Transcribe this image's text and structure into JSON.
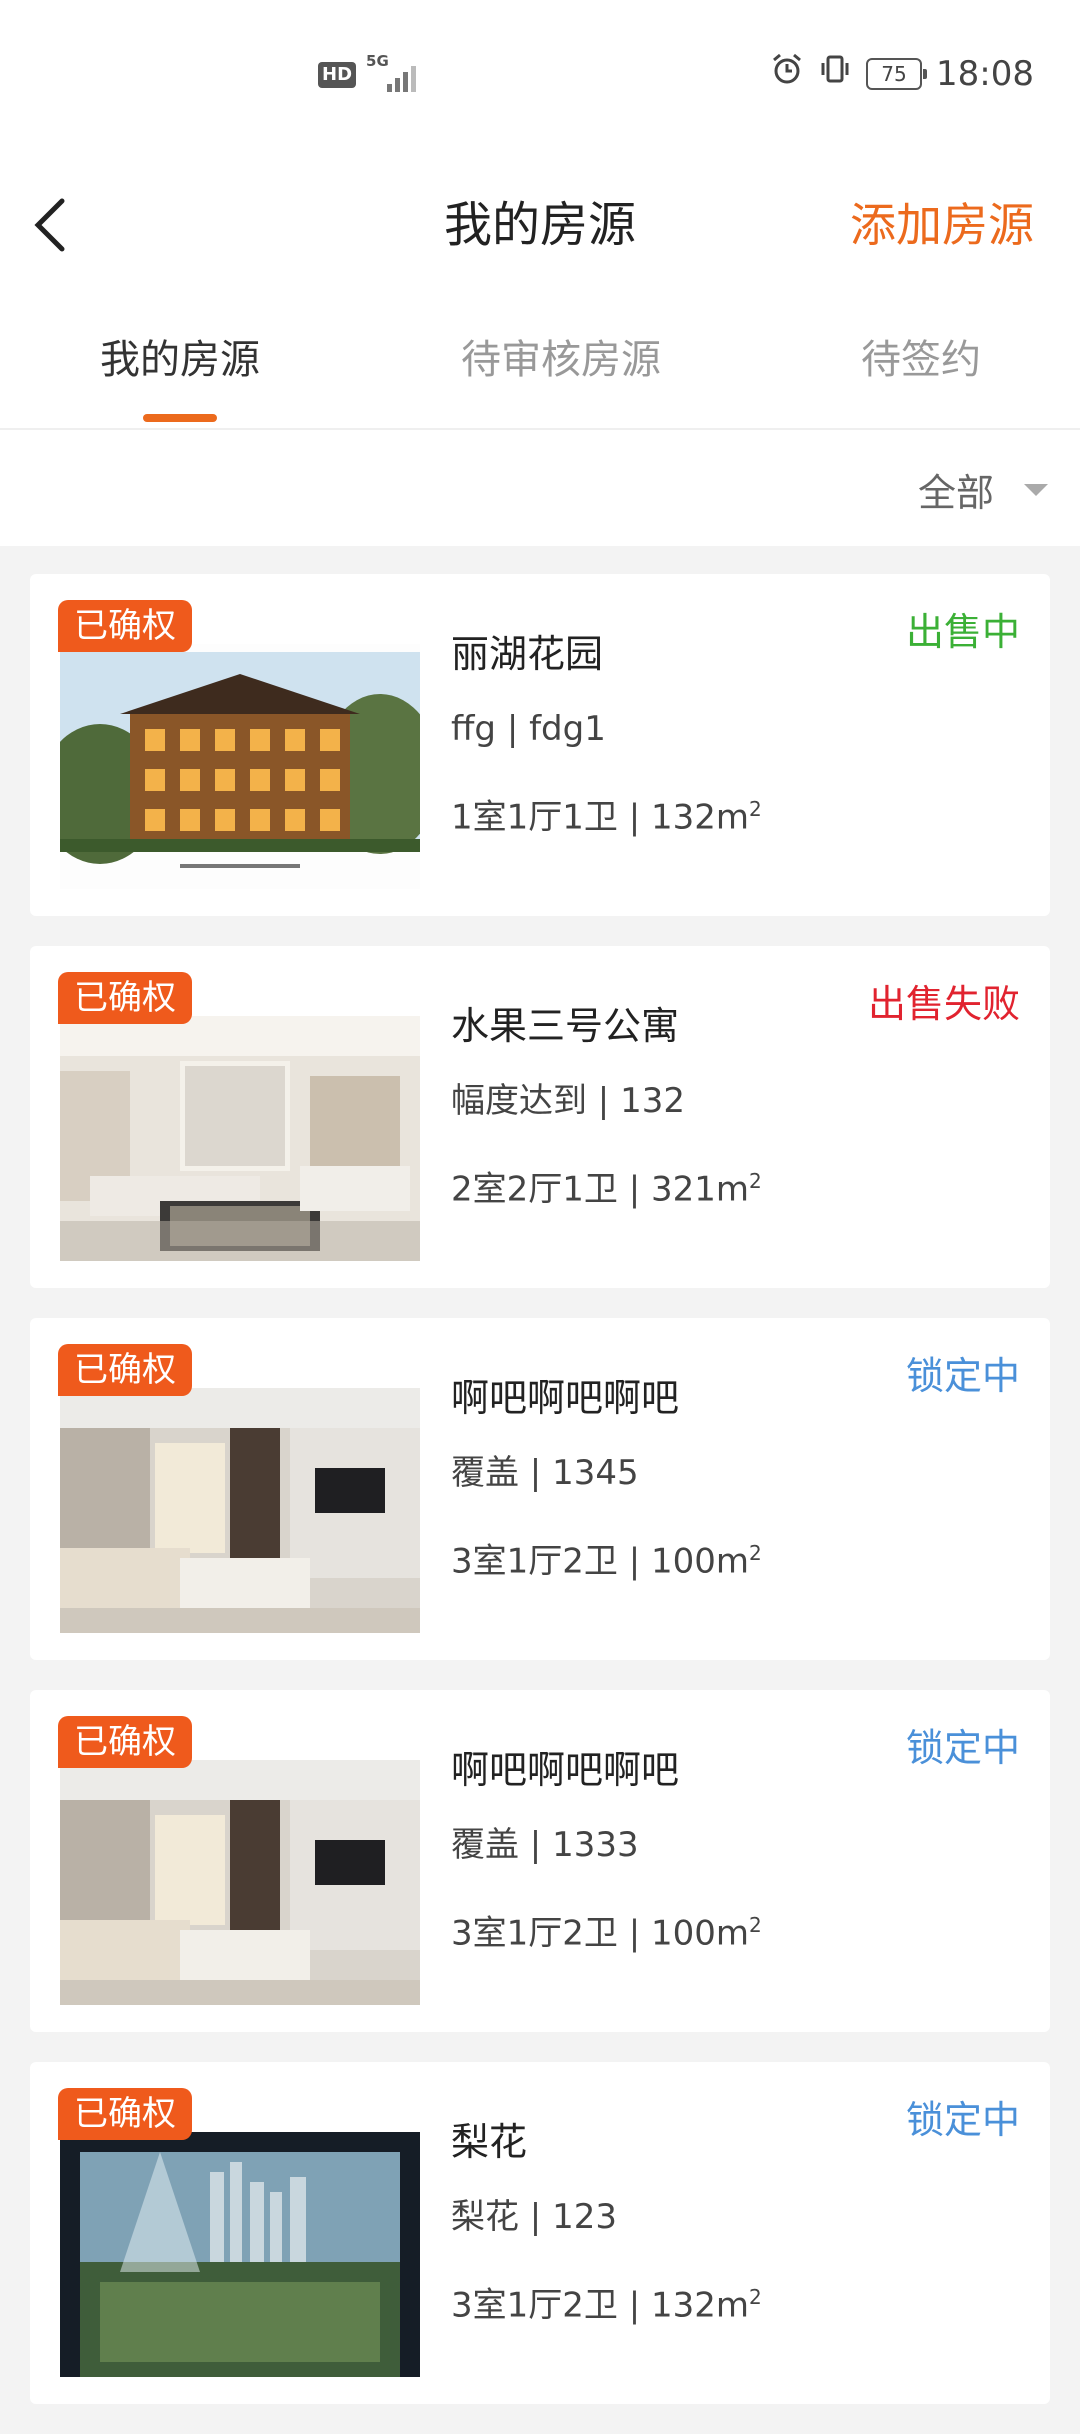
{
  "status_bar": {
    "hd": "HD",
    "network": "5G",
    "battery": "75",
    "time": "18:08",
    "icons": [
      "alarm-icon",
      "vibrate-icon"
    ]
  },
  "header": {
    "title": "我的房源",
    "add_label": "添加房源",
    "accent": "#ec6a1d"
  },
  "tabs": [
    {
      "label": "我的房源",
      "active": true
    },
    {
      "label": "待审核房源",
      "active": false
    },
    {
      "label": "待签约",
      "active": false
    }
  ],
  "filter": {
    "label": "全部"
  },
  "listings": [
    {
      "badge": "已确权",
      "title": "丽湖花园",
      "sub": "ffg | fdg1",
      "spec": "1室1厅1卫 | 132m",
      "status": "出售中",
      "status_color": "#3bb036",
      "scene": "villa"
    },
    {
      "badge": "已确权",
      "title": "水果三号公寓",
      "sub": "幅度达到 | 132",
      "spec": "2室2厅1卫 | 321m",
      "status": "出售失败",
      "status_color": "#e1232f",
      "scene": "living"
    },
    {
      "badge": "已确权",
      "title": "啊吧啊吧啊吧",
      "sub": "覆盖 | 1345",
      "spec": "3室1厅2卫 | 100m",
      "status": "锁定中",
      "status_color": "#4a90d9",
      "scene": "interior"
    },
    {
      "badge": "已确权",
      "title": "啊吧啊吧啊吧",
      "sub": "覆盖 | 1333",
      "spec": "3室1厅2卫 | 100m",
      "status": "锁定中",
      "status_color": "#4a90d9",
      "scene": "interior"
    },
    {
      "badge": "已确权",
      "title": "梨花",
      "sub": "梨花 | 123",
      "spec": "3室1厅2卫 | 132m",
      "status": "锁定中",
      "status_color": "#4a90d9",
      "scene": "model"
    }
  ]
}
